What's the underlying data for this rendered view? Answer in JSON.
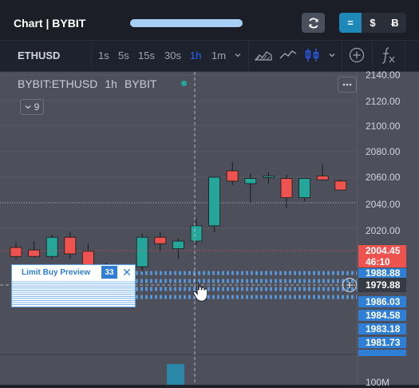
{
  "header": {
    "title": "Chart | BYBIT",
    "progress": 1.0,
    "currency_buttons": [
      "=",
      "$",
      "Ƀ"
    ],
    "active_currency_index": 0
  },
  "toolbar": {
    "symbol": "ETHUSD",
    "timeframes": [
      "1s",
      "5s",
      "15s",
      "30s",
      "1h",
      "1m"
    ],
    "active_timeframe": "1h",
    "icons": [
      "area-chart-icon",
      "line-chart-icon",
      "candles-icon",
      "chevron-down-icon",
      "add-indicator-icon",
      "function-icon"
    ]
  },
  "legend": {
    "symbol": "BYBIT:ETHUSD",
    "interval": "1h",
    "exchange": "BYBIT",
    "collapse_count": "9"
  },
  "price_axis": {
    "labels": [
      "2140.00",
      "2120.00",
      "2100.00",
      "2080.00",
      "2060.00",
      "2040.00",
      "2020.00"
    ],
    "lower_labels": [
      "1986.03",
      "1984.58",
      "1983.18",
      "1981.73"
    ],
    "volume_label": "100M"
  },
  "tags": {
    "last_price": "2004.45",
    "countdown": "46:10",
    "order_price": "1988.88",
    "crosshair_price": "1979.88"
  },
  "order": {
    "label": "Limit Buy Preview",
    "quantity": "33",
    "close_symbol": "✕"
  },
  "colors": {
    "up": "#26a69a",
    "down": "#ef5350",
    "accent": "#2962ff",
    "order": "#2f7fd6",
    "chart_bg": "#4d505a"
  },
  "chart_data": {
    "type": "candlestick",
    "symbol": "BYBIT:ETHUSD",
    "interval": "1h",
    "ylim": [
      1980,
      2140
    ],
    "candles": [
      {
        "open": 2005,
        "high": 2009,
        "low": 1996,
        "close": 1998
      },
      {
        "open": 2003,
        "high": 2010,
        "low": 1997,
        "close": 1998
      },
      {
        "open": 1998,
        "high": 2015,
        "low": 1996,
        "close": 2013
      },
      {
        "open": 2013,
        "high": 2017,
        "low": 1996,
        "close": 2000
      },
      {
        "open": 2002,
        "high": 2008,
        "low": 1986,
        "close": 1985
      },
      {
        "open": 1984,
        "high": 1993,
        "low": 1979,
        "close": 1981
      },
      {
        "open": 1981,
        "high": 1990,
        "low": 1979,
        "close": 1984
      },
      {
        "open": 1990,
        "high": 2016,
        "low": 1986,
        "close": 2013
      },
      {
        "open": 2013,
        "high": 2017,
        "low": 2002,
        "close": 2008
      },
      {
        "open": 2004,
        "high": 2012,
        "low": 1996,
        "close": 2010
      },
      {
        "open": 2010,
        "high": 2028,
        "low": 2007,
        "close": 2022
      },
      {
        "open": 2022,
        "high": 2054,
        "low": 2017,
        "close": 2060
      },
      {
        "open": 2065,
        "high": 2072,
        "low": 2054,
        "close": 2057
      },
      {
        "open": 2055,
        "high": 2063,
        "low": 2040,
        "close": 2059
      },
      {
        "open": 2061,
        "high": 2064,
        "low": 2055,
        "close": 2061
      },
      {
        "open": 2059,
        "high": 2062,
        "low": 2036,
        "close": 2044
      },
      {
        "open": 2044,
        "high": 2059,
        "low": 2041,
        "close": 2059
      },
      {
        "open": 2061,
        "high": 2070,
        "low": 2057,
        "close": 2058
      },
      {
        "open": 2057,
        "high": 2058,
        "low": 2050,
        "close": 2050
      }
    ],
    "last_price": 2004.45,
    "limit_order_price": 1988.88,
    "crosshair_price": 1979.88
  }
}
